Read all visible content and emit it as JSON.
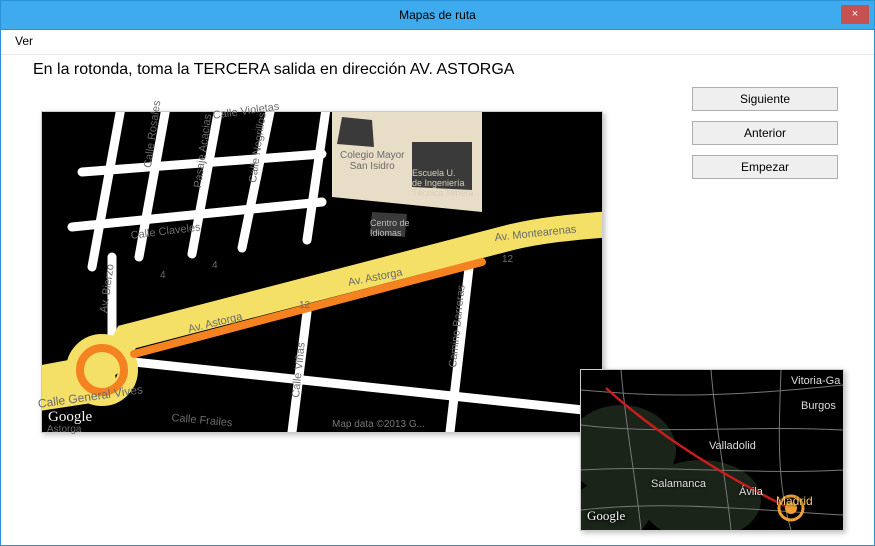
{
  "window": {
    "title": "Mapas de ruta",
    "close_glyph": "×"
  },
  "menu": {
    "ver": "Ver"
  },
  "instruction": "En la rotonda, toma la TERCERA salida en dirección AV. ASTORGA",
  "buttons": {
    "next": "Siguiente",
    "prev": "Anterior",
    "start": "Empezar"
  },
  "main_map": {
    "logo": "Google",
    "attribution": "Map data ©2013 G...",
    "roads": {
      "av_astorga": "Av. Astorga",
      "av_montearenas": "Av. Montearenas",
      "calle_general_vives": "Calle General Vives",
      "av_bierzo": "Av. Bierzo",
      "calle_rosales": "Calle Rosales",
      "pasaje_acacias": "Pasaje Acacias",
      "calle_negrillos": "Calle Negrillos",
      "calle_violetas": "Calle Violetas",
      "calle_claveles": "Calle Claveles",
      "calle_frailes": "Calle Frailes",
      "calle_vinas": "Calle Viñas",
      "camino_barreras": "Camino Barreras",
      "calle_astorga": "Astorga"
    },
    "pois": {
      "colegio_mayor": "Colegio Mayor\nSan Isidro",
      "escuela_u": "Escuela U.\nde Ingeniería\nTécnica Minera",
      "centro_idiomas": "Centro de\nIdiomas"
    },
    "house_numbers": [
      "4",
      "4",
      "12",
      "12"
    ]
  },
  "mini_map": {
    "logo": "Google",
    "cities": {
      "madrid": "Madrid",
      "valladolid": "Valladolid",
      "salamanca": "Salamanca",
      "avila": "Ávila",
      "burgos": "Burgos",
      "vitoria": "Vitoria-Ga"
    }
  }
}
